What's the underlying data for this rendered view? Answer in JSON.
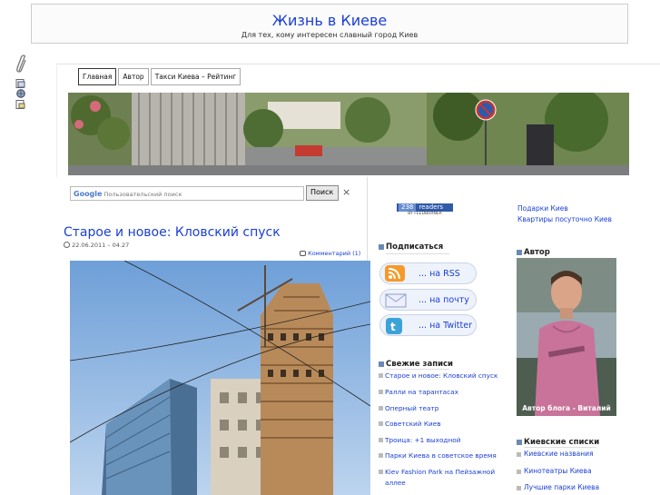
{
  "site": {
    "title": "Жизнь в Киеве",
    "description": "Для тех, кому интересен славный город Киев"
  },
  "nav": {
    "items": [
      "Главная",
      "Автор",
      "Такси Киева – Рейтинг"
    ]
  },
  "search": {
    "placeholder": "Пользовательский поиск",
    "google": "Google",
    "button": "Поиск",
    "close": "×"
  },
  "post": {
    "title": "Старое и новое: Кловский спуск",
    "date": "22.06.2011 – 04.27",
    "comments": "Комментарий (1)"
  },
  "feedburner": {
    "count": "238",
    "readers": "readers",
    "by": "BY FEEDBURNER"
  },
  "subscribe": {
    "title": "Подписаться",
    "rss": "... на RSS",
    "email": "... на почту",
    "twitter": "... на Twitter"
  },
  "recent": {
    "title": "Свежие записи",
    "items": [
      "Старое и новое: Кловский спуск",
      "Ралли на тарантасах",
      "Оперный театр",
      "Советский Киев",
      "Троица: +1 выходной",
      "Парки Киева в советское время",
      "Kiev Fashion Park на Пейзажной аллее"
    ]
  },
  "right": {
    "links": [
      "Подарки Киев",
      "Квартиры посуточно Киев"
    ],
    "author_title": "Автор",
    "author_caption": "Автор блога - Виталий",
    "lists_title": "Киевские списки",
    "lists": [
      "Киевские названия",
      "Кинотеатры Киева",
      "Лучшие парки Киева"
    ]
  }
}
